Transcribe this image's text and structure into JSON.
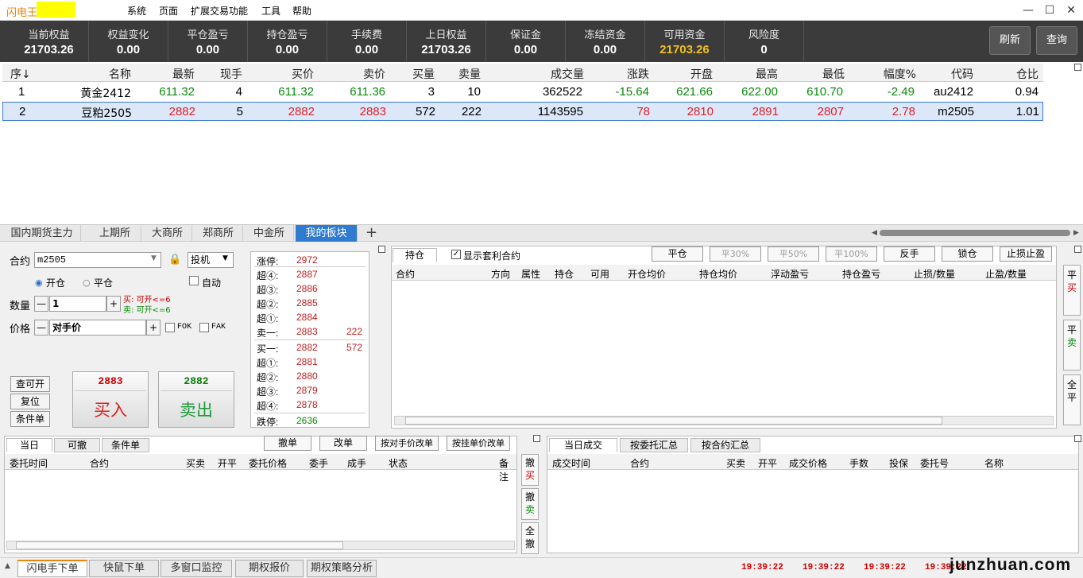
{
  "app": {
    "title": "闪电王-",
    "menu": [
      "系统",
      "页面",
      "扩展交易功能",
      "工具",
      "帮助"
    ]
  },
  "summary": [
    {
      "label": "当前权益",
      "value": "21703.26",
      "highlight": false
    },
    {
      "label": "权益变化",
      "value": "0.00",
      "highlight": false
    },
    {
      "label": "平仓盈亏",
      "value": "0.00",
      "highlight": false
    },
    {
      "label": "持仓盈亏",
      "value": "0.00",
      "highlight": false
    },
    {
      "label": "手续费",
      "value": "0.00",
      "highlight": false
    },
    {
      "label": "上日权益",
      "value": "21703.26",
      "highlight": false
    },
    {
      "label": "保证金",
      "value": "0.00",
      "highlight": false
    },
    {
      "label": "冻结资金",
      "value": "0.00",
      "highlight": false
    },
    {
      "label": "可用资金",
      "value": "21703.26",
      "highlight": true
    },
    {
      "label": "风险度",
      "value": "0",
      "highlight": false
    }
  ],
  "buttons": {
    "refresh": "刷新",
    "query": "查询"
  },
  "quote": {
    "headers": [
      "序",
      "名称",
      "最新",
      "现手",
      "买价",
      "卖价",
      "买量",
      "卖量",
      "成交量",
      "涨跌",
      "开盘",
      "最高",
      "最低",
      "幅度%",
      "代码",
      "仓比"
    ],
    "sort_arrow": "↓",
    "rows": [
      {
        "no": "1",
        "name": "黄金2412",
        "last": "611.32",
        "cur": "4",
        "bid": "611.32",
        "ask": "611.36",
        "bidvol": "3",
        "askvol": "10",
        "volume": "362522",
        "chg": "-15.64",
        "open": "621.66",
        "high": "622.00",
        "low": "610.70",
        "pct": "-2.49",
        "code": "au2412",
        "ratio": "0.94"
      },
      {
        "no": "2",
        "name": "豆粕2505",
        "last": "2882",
        "cur": "5",
        "bid": "2882",
        "ask": "2883",
        "bidvol": "572",
        "askvol": "222",
        "volume": "1143595",
        "chg": "78",
        "open": "2810",
        "high": "2891",
        "low": "2807",
        "pct": "2.78",
        "code": "m2505",
        "ratio": "1.01"
      }
    ]
  },
  "market_tabs": [
    "国内期货主力",
    "上期所",
    "大商所",
    "郑商所",
    "中金所",
    "我的板块"
  ],
  "market_tab_add": "+",
  "order": {
    "contract_label": "合约",
    "contract_value": "m2505",
    "hedge_value": "投机",
    "open_label": "开仓",
    "close_label": "平仓",
    "auto_label": "自动",
    "qty_label": "数量",
    "qty_value": "1",
    "buy_hint": "买: 可开<=6",
    "sell_hint": "卖: 可开<=6",
    "price_label": "价格",
    "price_value": "对手价",
    "fok": "FOK",
    "fak": "FAK",
    "query_open": "查可开",
    "reset": "复位",
    "cond_order": "条件单",
    "buy_price": "2883",
    "buy_label": "买入",
    "sell_price": "2882",
    "sell_label": "卖出",
    "minus": "—",
    "plus": "+"
  },
  "depth": {
    "limit_up_label": "涨停:",
    "limit_up": "2972",
    "asks": [
      {
        "label": "超④:",
        "price": "2887",
        "vol": ""
      },
      {
        "label": "超③:",
        "price": "2886",
        "vol": ""
      },
      {
        "label": "超②:",
        "price": "2885",
        "vol": ""
      },
      {
        "label": "超①:",
        "price": "2884",
        "vol": ""
      },
      {
        "label": "卖一:",
        "price": "2883",
        "vol": "222"
      }
    ],
    "bids": [
      {
        "label": "买一:",
        "price": "2882",
        "vol": "572"
      },
      {
        "label": "超①:",
        "price": "2881",
        "vol": ""
      },
      {
        "label": "超②:",
        "price": "2880",
        "vol": ""
      },
      {
        "label": "超③:",
        "price": "2879",
        "vol": ""
      },
      {
        "label": "超④:",
        "price": "2878",
        "vol": ""
      }
    ],
    "limit_down_label": "跌停:",
    "limit_down": "2636"
  },
  "positions": {
    "tab": "持仓",
    "show_arb": "显示套利合约",
    "buttons": [
      "平仓",
      "平30%",
      "平50%",
      "平100%",
      "反手",
      "锁仓",
      "止损止盈"
    ],
    "headers": [
      "合约",
      "方向",
      "属性",
      "持仓",
      "可用",
      "开仓均价",
      "持仓均价",
      "浮动盈亏",
      "持仓盈亏",
      "止损/数量",
      "止盈/数量"
    ],
    "side_buttons": [
      {
        "top": "平",
        "bottom": "买"
      },
      {
        "top": "平",
        "bottom": "卖"
      },
      {
        "top": "全",
        "bottom": "平"
      }
    ]
  },
  "orders": {
    "tabs": [
      "当日",
      "可撤",
      "条件单"
    ],
    "buttons": [
      "撤单",
      "改单",
      "按对手价改单",
      "按挂单价改单"
    ],
    "headers": [
      "委托时间",
      "合约",
      "买卖",
      "开平",
      "委托价格",
      "委手",
      "成手",
      "状态",
      "备注"
    ],
    "side_buttons": [
      {
        "top": "撤",
        "bottom": "买"
      },
      {
        "top": "撤",
        "bottom": "卖"
      },
      {
        "top": "全",
        "bottom": "撤"
      }
    ]
  },
  "trades": {
    "tabs": [
      "当日成交",
      "按委托汇总",
      "按合约汇总"
    ],
    "headers": [
      "成交时间",
      "合约",
      "买卖",
      "开平",
      "成交价格",
      "手数",
      "投保",
      "委托号",
      "名称"
    ]
  },
  "bottom_tabs": [
    "闪电手下单",
    "快鼠下单",
    "多窗口监控",
    "期权报价",
    "期权策略分析"
  ],
  "clocks": [
    "19:39:22",
    "19:39:22",
    "19:39:22",
    "19:39:22"
  ],
  "watermark": "junzhuan.com"
}
